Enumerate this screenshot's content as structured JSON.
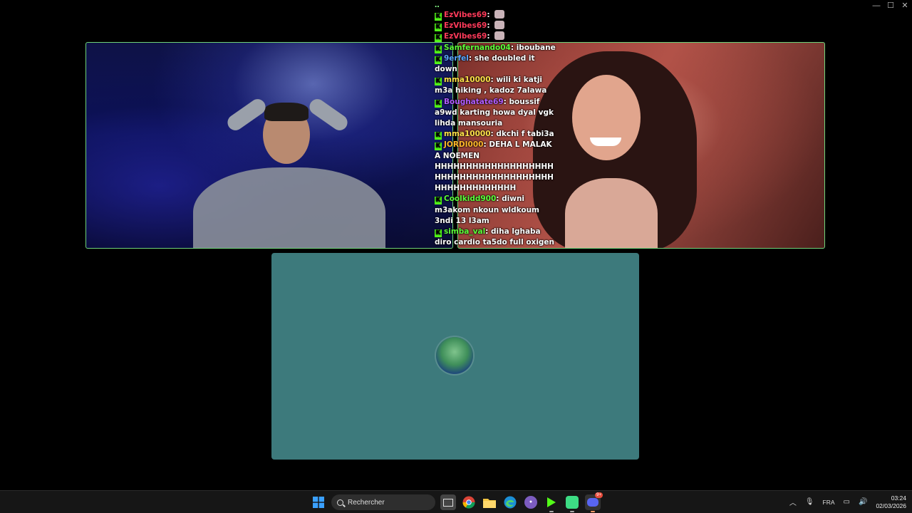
{
  "window": {
    "controls": {
      "minimize": "—",
      "maximize": "☐",
      "close": "✕"
    }
  },
  "chat": {
    "messages": [
      {
        "user": "EzVibes69",
        "user_color": "#ff3a5a",
        "text": "",
        "emote": true
      },
      {
        "user": "EzVibes69",
        "user_color": "#ff3a5a",
        "text": "",
        "emote": true
      },
      {
        "user": "EzVibes69",
        "user_color": "#ff3a5a",
        "text": "",
        "emote": true
      },
      {
        "user": "Samfernando04",
        "user_color": "#5cff3a",
        "text": "iboubane"
      },
      {
        "user": "9erfel",
        "user_color": "#5aa7ff",
        "text": "she doubled it down"
      },
      {
        "user": "mma10000",
        "user_color": "#ffe24a",
        "text": "wili ki katji m3a hiking , kadoz 7alawa"
      },
      {
        "user": "Boughatate69",
        "user_color": "#b05cff",
        "text": "boussif a9wd karting howa dyal vgk lihda mansouria"
      },
      {
        "user": "mma10000",
        "user_color": "#ffe24a",
        "text": "dkchi f tabi3a"
      },
      {
        "user": "JORDI000",
        "user_color": "#ffb72a",
        "text": "DEHA L MALAK A NOEMEN HHHHHHHHHHHHHHHHHHH HHHHHHHHHHHHHHHHHHH HHHHHHHHHHHHH"
      },
      {
        "user": "Coolkidd900",
        "user_color": "#5cff3a",
        "text": "diwni m3akom nkoun wldkoum 3ndi 13 l3am"
      },
      {
        "user": "simba_val",
        "user_color": "#5cff3a",
        "text": "diha lghaba diro cardio ta5do full oxigen"
      }
    ]
  },
  "taskbar": {
    "search_placeholder": "Rechercher",
    "language": "FRA",
    "time": "03:24",
    "date": "02/03/2026",
    "discord_badge": "9+"
  }
}
